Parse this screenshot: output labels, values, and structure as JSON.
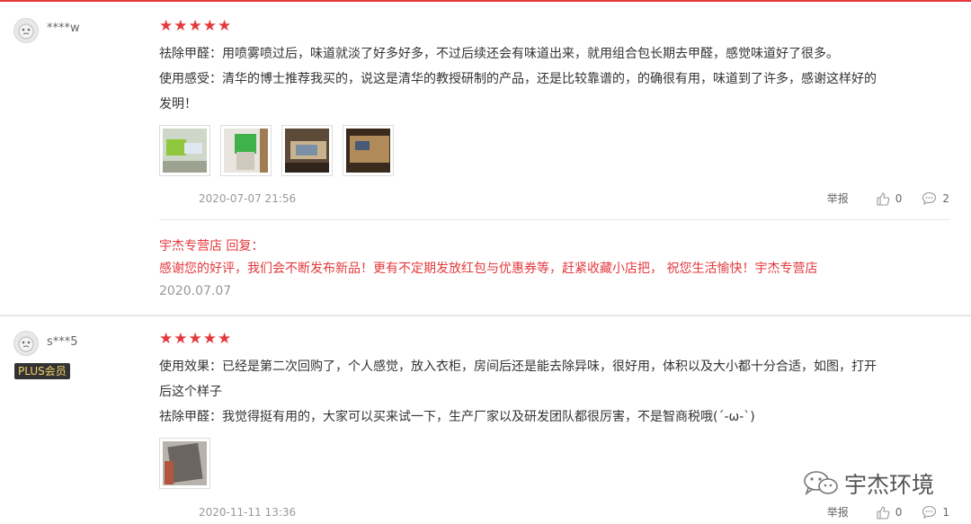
{
  "reviews": [
    {
      "username": "****w",
      "rating": 5,
      "lines": [
        "祛除甲醛：用喷雾喷过后，味道就淡了好多好多，不过后续还会有味道出来，就用组合包长期去甲醛，感觉味道好了很多。",
        "使用感受：清华的博士推荐我买的，说这是清华的教授研制的产品，还是比较靠谱的，的确很有用，味道到了许多，感谢这样好的",
        "发明！"
      ],
      "date": "2020-07-07 21:56",
      "report_label": "举报",
      "likes": "0",
      "comments": "2",
      "reply": {
        "header": "宇杰专营店 回复：",
        "body": "感谢您的好评，我们会不断发布新品！更有不定期发放红包与优惠券等，赶紧收藏小店把， 祝您生活愉快！宇杰专营店",
        "date": "2020.07.07"
      }
    },
    {
      "username": "s***5",
      "badge": "PLUS会员",
      "rating": 5,
      "lines": [
        "使用效果：已经是第二次回购了，个人感觉，放入衣柜，房间后还是能去除异味，很好用，体积以及大小都十分合适，如图，打开",
        "后这个样子",
        "祛除甲醛：我觉得挺有用的，大家可以买来试一下，生产厂家以及研发团队都很厉害，不是智商税哦(´-ω-`)"
      ],
      "date": "2020-11-11 13:36",
      "report_label": "举报",
      "likes": "0",
      "comments": "1"
    }
  ],
  "watermark": "宇杰环境",
  "colors": {
    "accent": "#e4393c",
    "badge_bg": "#333333",
    "badge_text": "#f5d36c"
  },
  "icons": {
    "star": "star-icon",
    "like": "thumbs-up-icon",
    "comment": "comment-icon",
    "avatar": "avatar-icon",
    "watermark": "wechat-icon"
  }
}
